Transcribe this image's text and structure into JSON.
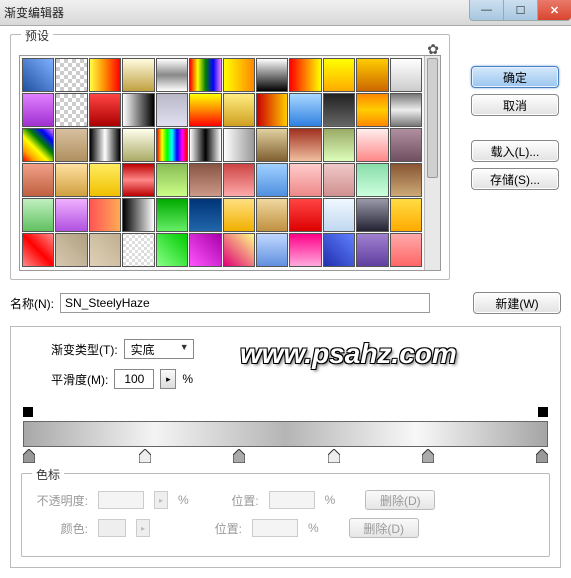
{
  "window": {
    "title": "渐变编辑器",
    "min_label": "—",
    "max_label": "☐",
    "close_label": "✕"
  },
  "presets": {
    "legend": "预设",
    "gear_icon": "✿"
  },
  "buttons": {
    "ok": "确定",
    "cancel": "取消",
    "load": "载入(L)...",
    "save": "存储(S)...",
    "new": "新建(W)"
  },
  "name": {
    "label": "名称(N):",
    "value": "SN_SteelyHaze"
  },
  "editor": {
    "type_label": "渐变类型(T):",
    "type_value": "实底",
    "smooth_label": "平滑度(M):",
    "smooth_value": "100",
    "percent": "%",
    "spin_icon": "▸"
  },
  "color_stops": {
    "legend": "色标",
    "opacity_label": "不透明度:",
    "color_label": "颜色:",
    "position_label": "位置:",
    "delete_label": "删除(D)",
    "percent": "%"
  },
  "watermark": "www.psahz.com",
  "swatches": [
    "linear-gradient(45deg,#2050a0,#80b0ff)",
    "repeating-conic-gradient(#ccc 0 25%,#fff 0 50%) 0/8px 8px",
    "linear-gradient(90deg,#ff4,#f80,#f00)",
    "linear-gradient(#fffbe0,#c0a040)",
    "linear-gradient(#fff,#888,#fff)",
    "linear-gradient(90deg,red,yellow,green,blue,violet)",
    "linear-gradient(90deg,#ff0,#f80)",
    "linear-gradient(#fff,#000)",
    "linear-gradient(90deg,#f00,#ff0)",
    "linear-gradient(#ff0,#fa0)",
    "linear-gradient(#fc0,#c60)",
    "linear-gradient(#fff,#ccc)",
    "linear-gradient(#e080ff,#a030d0)",
    "repeating-conic-gradient(#ccc 0 25%,#fff 0 50%) 0/8px 8px",
    "linear-gradient(#f44,#a00)",
    "linear-gradient(90deg,#fff,#000)",
    "linear-gradient(#b8b8c8,#e0e0f0)",
    "linear-gradient(#ff0,#f80,#f00)",
    "linear-gradient(#ffec80,#d0a020)",
    "linear-gradient(90deg,#c00,#fc0)",
    "linear-gradient(#a8d8ff,#3080e0)",
    "linear-gradient(#222,#666)",
    "linear-gradient(#f80,#fc0,#f80)",
    "linear-gradient(#777,#eee,#777)",
    "linear-gradient(45deg,red,orange,yellow,green,blue,violet)",
    "linear-gradient(#d8c0a0,#b09060)",
    "linear-gradient(90deg,#000,#fff,#000)",
    "linear-gradient(#ffe,#aa6)",
    "linear-gradient(90deg,red,yellow,lime,cyan,blue,magenta,red)",
    "linear-gradient(90deg,#fff,#000,#fff)",
    "linear-gradient(90deg,#fff,#999)",
    "linear-gradient(#e0d0a0,#806030)",
    "linear-gradient(#a03020,#f0c0a0)",
    "linear-gradient(#9a6,#dfb)",
    "linear-gradient(#fee,#f88)",
    "linear-gradient(#b090a0,#705060)",
    "linear-gradient(#f0a088,#c06040)",
    "linear-gradient(#ffe0a0,#d0a040)",
    "linear-gradient(#ffec60,#f0c000)",
    "linear-gradient(#b00,#f88,#b00)",
    "linear-gradient(#8b5,#cf8)",
    "linear-gradient(#854,#c98)",
    "linear-gradient(#c44,#faa)",
    "linear-gradient(#a0d0ff,#5090e0)",
    "linear-gradient(#fcc,#e88)",
    "linear-gradient(#f0c8c8,#d09090)",
    "linear-gradient(#8da,#cfd)",
    "linear-gradient(#853,#ca7)",
    "linear-gradient(#c0f0c0,#60c060)",
    "linear-gradient(#f0b0ff,#b050e0)",
    "linear-gradient(90deg,#f55,#fa5)",
    "linear-gradient(90deg,#000,#fff)",
    "linear-gradient(#0a0,#6e6)",
    "linear-gradient(#037,#26a)",
    "linear-gradient(#ffe080,#f0b000)",
    "linear-gradient(#f0d8a0,#c09040)",
    "linear-gradient(#f44,#d00)",
    "linear-gradient(#f0f8ff,#c0d8f0)",
    "linear-gradient(#99a,#223)",
    "linear-gradient(#fd4,#fa0)",
    "linear-gradient(45deg,#f88,#f00,#f88)",
    "linear-gradient(45deg,#d8c8b0,#b0a080)",
    "linear-gradient(45deg,#e0d0b8,#c0b090)",
    "repeating-conic-gradient(#ddd 0 25%,#fff 0 50%) 0/6px 6px",
    "linear-gradient(45deg,#8f8,#0c0)",
    "linear-gradient(45deg,#f5f,#a0a)",
    "linear-gradient(45deg,#e00076,#ff8)",
    "linear-gradient(#c0d8ff,#6090e0)",
    "linear-gradient(#f08,#fad)",
    "linear-gradient(45deg,#2030b0,#6080ff)",
    "linear-gradient(#a080d0,#6040a0)",
    "linear-gradient(#faa,#f66)"
  ]
}
